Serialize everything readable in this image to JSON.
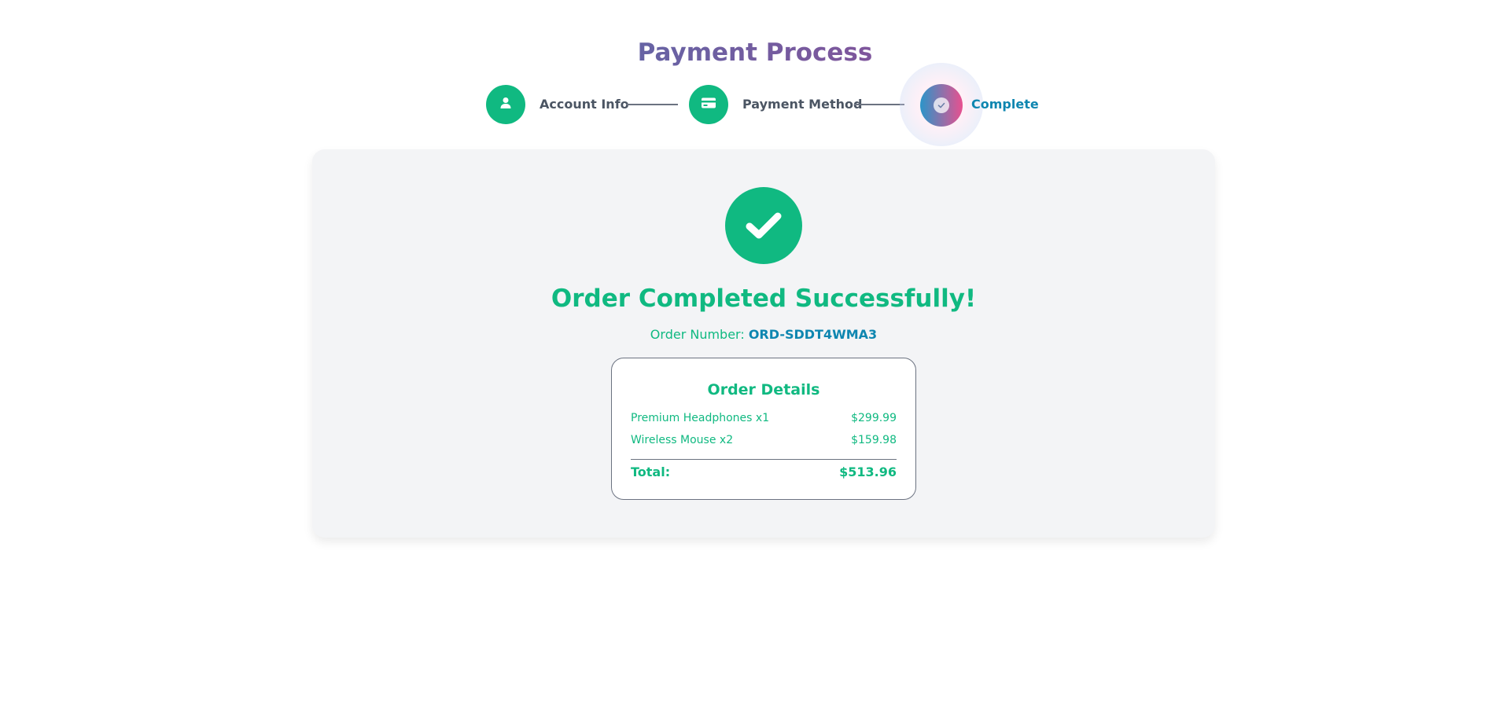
{
  "header": {
    "title": "Payment Process"
  },
  "stepper": {
    "steps": [
      {
        "label": "Account Info",
        "icon": "user-icon",
        "state": "completed"
      },
      {
        "label": "Payment Method",
        "icon": "credit-card-icon",
        "state": "completed"
      },
      {
        "label": "Complete",
        "icon": "check-circle-icon",
        "state": "active"
      }
    ]
  },
  "confirmation": {
    "icon": "checkmark-icon",
    "title": "Order Completed Successfully!",
    "order_number_label": "Order Number:",
    "order_number": "ORD-SDDT4WMA3"
  },
  "order_details": {
    "title": "Order Details",
    "items": [
      {
        "name": "Premium Headphones x1",
        "price": "$299.99"
      },
      {
        "name": "Wireless Mouse x2",
        "price": "$159.98"
      }
    ],
    "total_label": "Total:",
    "total_value": "$513.96"
  },
  "colors": {
    "accent": "#10b981",
    "link": "#0e86b0",
    "muted": "#4b5563",
    "card_bg": "#f3f4f6"
  }
}
